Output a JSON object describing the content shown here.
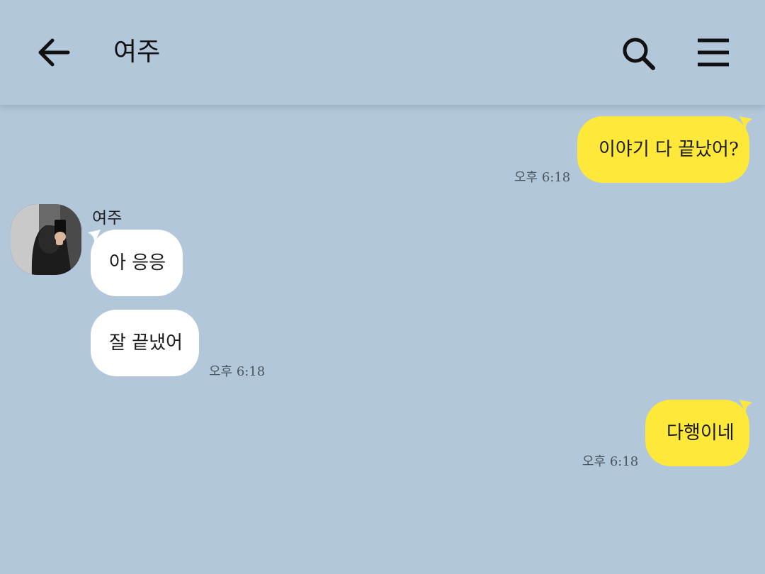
{
  "header": {
    "title": "여주",
    "back_icon": "arrow-left-icon",
    "search_icon": "search-icon",
    "menu_icon": "hamburger-menu-icon"
  },
  "colors": {
    "background": "#b2c7da",
    "my_bubble": "#fee93b",
    "their_bubble": "#ffffff"
  },
  "messages": [
    {
      "sender": "me",
      "text": "이야기 다 끝났어?",
      "time": "오후 6:18"
    },
    {
      "sender": "여주",
      "sender_name": "여주",
      "text": "아 응응"
    },
    {
      "sender": "여주",
      "text": "잘 끝냈어",
      "time": "오후 6:18"
    },
    {
      "sender": "me",
      "text": "다행이네",
      "time": "오후 6:18"
    }
  ]
}
